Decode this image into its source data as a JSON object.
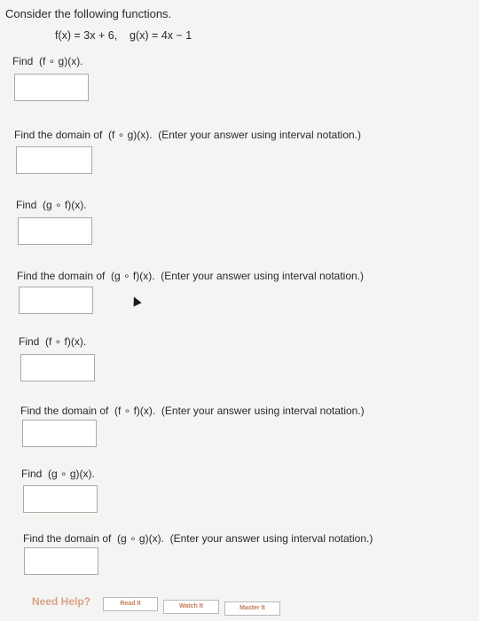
{
  "header": {
    "intro": "Consider the following functions.",
    "functions": "f(x) = 3x + 6,    g(x) = 4x − 1"
  },
  "questions": [
    {
      "prompt": "Find  (f ∘ g)(x).",
      "answer": ""
    },
    {
      "prompt": "Find the domain of  (f ∘ g)(x).  (Enter your answer using interval notation.)",
      "answer": ""
    },
    {
      "prompt": "Find  (g ∘ f)(x).",
      "answer": ""
    },
    {
      "prompt": "Find the domain of  (g ∘ f)(x).  (Enter your answer using interval notation.)",
      "answer": ""
    },
    {
      "prompt": "Find  (f ∘ f)(x).",
      "answer": ""
    },
    {
      "prompt": "Find the domain of  (f ∘ f)(x).  (Enter your answer using interval notation.)",
      "answer": ""
    },
    {
      "prompt": "Find  (g ∘ g)(x).",
      "answer": ""
    },
    {
      "prompt": "Find the domain of  (g ∘ g)(x).  (Enter your answer using interval notation.)",
      "answer": ""
    }
  ],
  "help": {
    "label": "Need Help?",
    "buttons": [
      "Read It",
      "Watch It",
      "Master It"
    ]
  }
}
